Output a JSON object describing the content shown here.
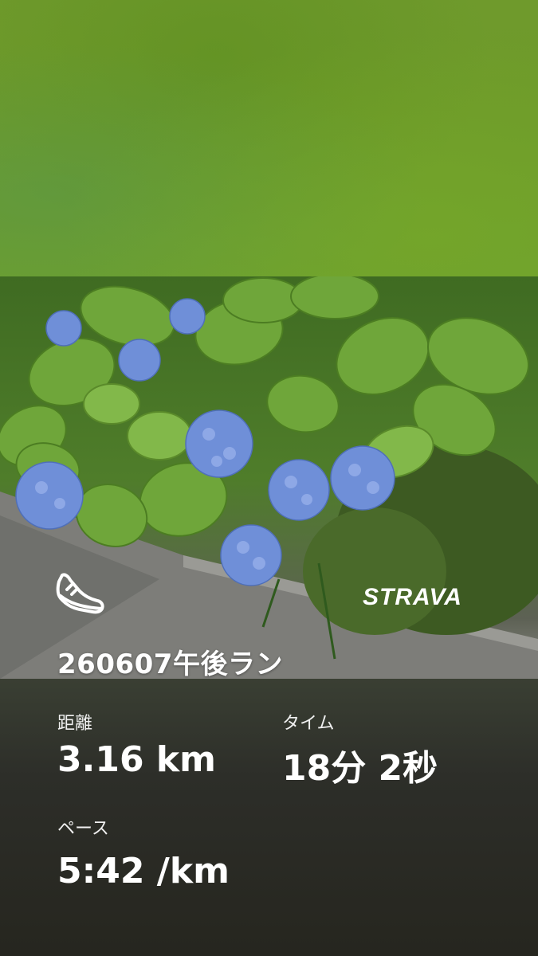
{
  "activity": {
    "title": "260607午後ラン",
    "sport_icon": "running-shoe-icon",
    "brand": "STRAVA"
  },
  "stats": {
    "distance_label": "距離",
    "distance_value": "3.16 km",
    "time_label": "タイム",
    "time_value": "18分 2秒",
    "pace_label": "ペース",
    "pace_value": "5:42 /km"
  },
  "colors": {
    "foliage_green": "#6e9b2a",
    "hydrangea_blue": "#6f8fd8",
    "panel_dark": "#2d2e29",
    "text": "#ffffff"
  }
}
